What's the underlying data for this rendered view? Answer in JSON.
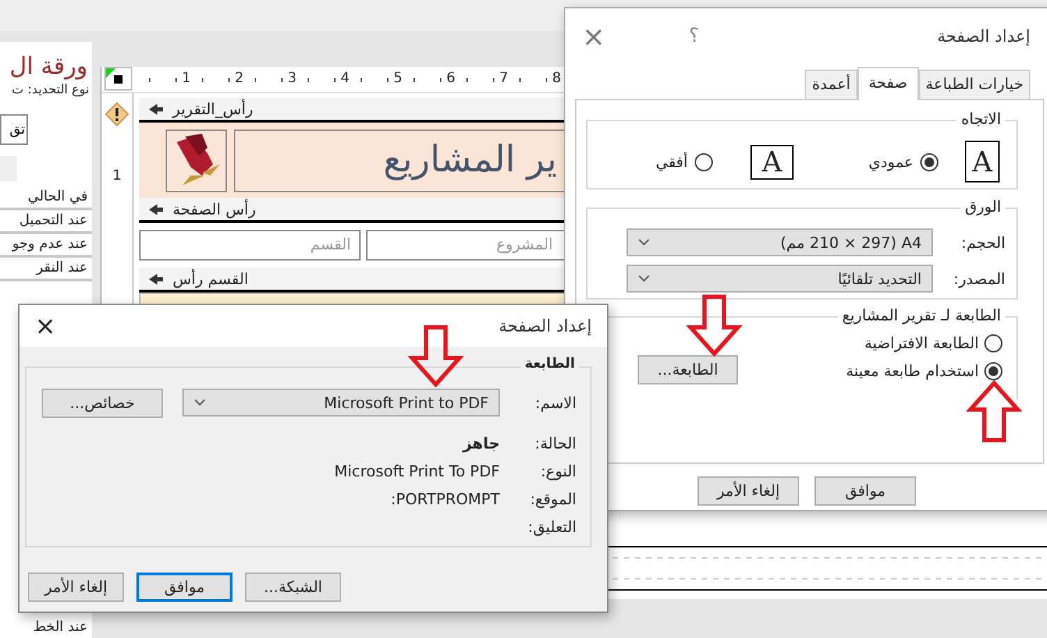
{
  "property_sheet": {
    "title": "ورقة ال",
    "selection_type": "نوع التحديد: ت",
    "button": "تق",
    "events": [
      "في الحالي",
      "عند التحميل",
      "عند عدم وجو",
      "عند النقر"
    ],
    "last_event": "عند الخط"
  },
  "report_designer": {
    "ruler_numbers": [
      "8",
      "7",
      "6",
      "5",
      "4",
      "3",
      "2",
      "1"
    ],
    "vertical_ruler_number": "1",
    "report_header": {
      "label": "رأس_التقرير",
      "title": "ير المشاريع"
    },
    "page_header": {
      "label": "رأس الصفحة",
      "fields": [
        "المشروع",
        "القسم"
      ]
    },
    "group_header": {
      "label": "القسم رأس"
    }
  },
  "page_setup_dialog": {
    "title": "إعداد الصفحة",
    "help": "؟",
    "close": "×",
    "tabs": [
      {
        "label": "خيارات الطباعة",
        "selected": false
      },
      {
        "label": "صفحة",
        "selected": true
      },
      {
        "label": "أعمدة",
        "selected": false
      }
    ],
    "orientation": {
      "legend": "الاتجاه",
      "options": [
        {
          "label": "عمودي",
          "kind": "portrait",
          "glyph": "A",
          "selected": true
        },
        {
          "label": "أفقي",
          "kind": "landscape",
          "glyph": "A",
          "selected": false
        }
      ]
    },
    "paper": {
      "legend": "الورق",
      "fields": [
        {
          "label": "الحجم:",
          "value": "A4 (210 × 297 مم)"
        },
        {
          "label": "المصدر:",
          "value": "التحديد تلقائيًا"
        }
      ]
    },
    "printer": {
      "legend": "الطابعة لـ تقرير المشاريع",
      "options": [
        {
          "label": "الطابعة الافتراضية",
          "selected": false
        },
        {
          "label": "استخدام طابعة معينة",
          "selected": true
        }
      ],
      "button": "الطابعة..."
    },
    "buttons": [
      {
        "label": "موافق",
        "default": false
      },
      {
        "label": "إلغاء الأمر",
        "default": false
      }
    ]
  },
  "printer_dialog": {
    "title": "إعداد الصفحة",
    "close": "×",
    "legend": "الطابعة",
    "name": {
      "label": "الاسم:",
      "value": "Microsoft Print to PDF"
    },
    "properties_button": "خصائص...",
    "info": [
      {
        "label": "الحالة:",
        "value": "جاهز",
        "strong": true
      },
      {
        "label": "النوع:",
        "value": "Microsoft Print To PDF",
        "strong": false
      },
      {
        "label": "الموقع:",
        "value": "PORTPROMPT:",
        "strong": false
      },
      {
        "label": "التعليق:",
        "strong": false
      }
    ],
    "buttons": [
      {
        "label": "الشبكة...",
        "default": false
      },
      {
        "label": "موافق",
        "default": true
      },
      {
        "label": "إلغاء الأمر",
        "default": false
      }
    ]
  }
}
